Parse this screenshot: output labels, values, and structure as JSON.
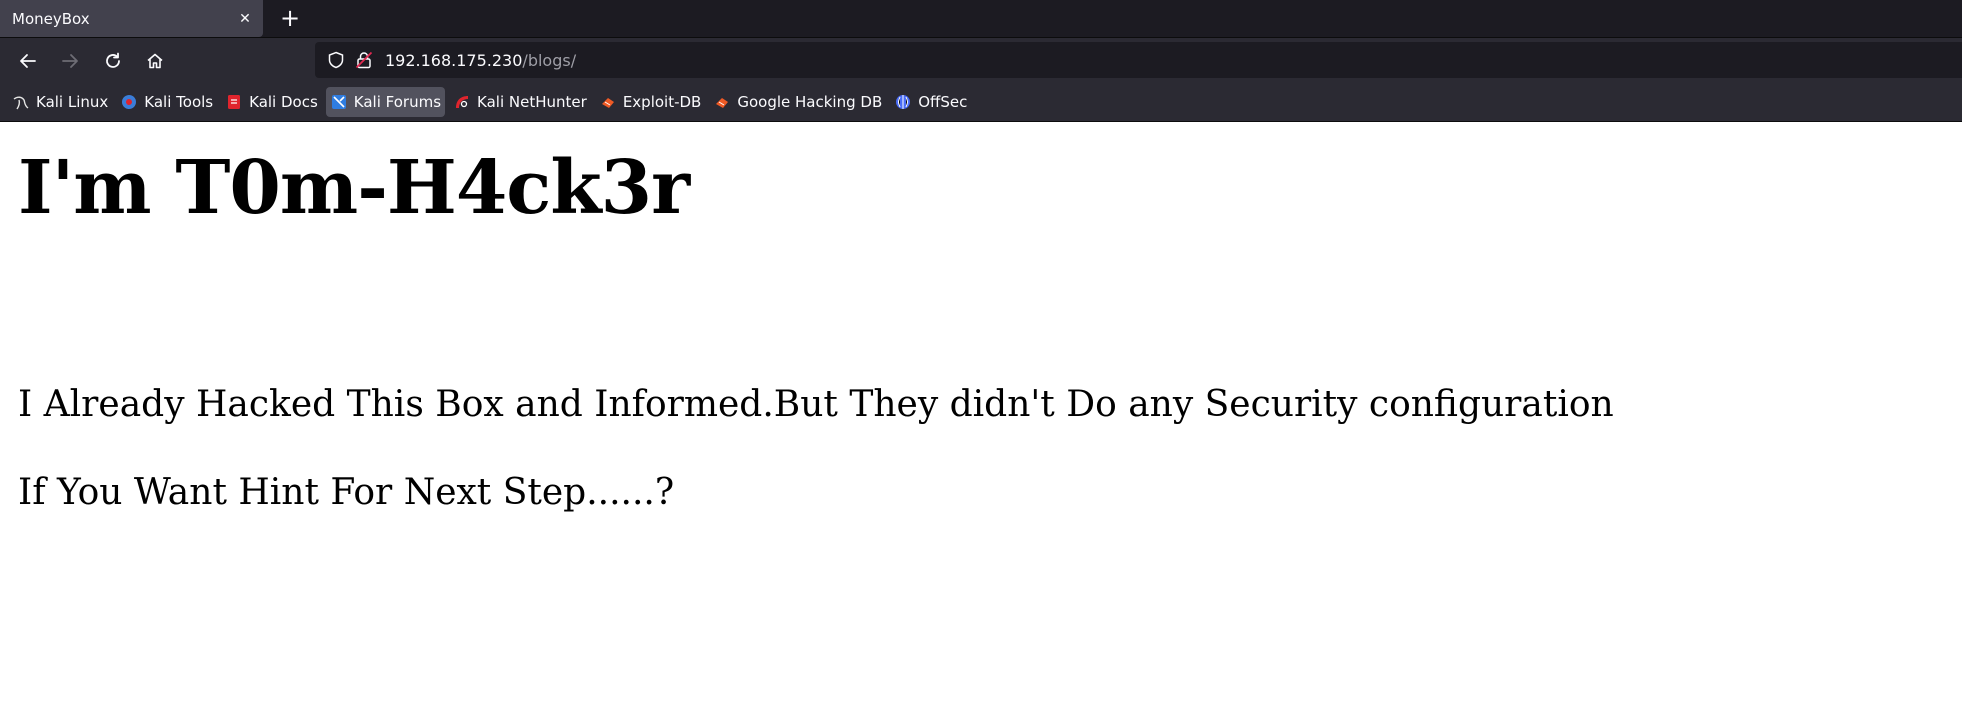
{
  "browser": {
    "tab": {
      "title": "MoneyBox",
      "close_glyph": "✕"
    },
    "new_tab_glyph": "+",
    "address": {
      "host": "192.168.175.230",
      "path": "/blogs/"
    },
    "bookmarks": [
      {
        "label": "Kali Linux",
        "icon": "kali-dragon-icon",
        "color": "#e5e5e5"
      },
      {
        "label": "Kali Tools",
        "icon": "kali-tools-icon",
        "color": "#3b7dd8"
      },
      {
        "label": "Kali Docs",
        "icon": "kali-docs-icon",
        "color": "#e0242d"
      },
      {
        "label": "Kali Forums",
        "icon": "kali-forums-icon",
        "color": "#2f7de1"
      },
      {
        "label": "Kali NetHunter",
        "icon": "nethunter-icon",
        "color": "#e0242d"
      },
      {
        "label": "Exploit-DB",
        "icon": "exploit-db-icon",
        "color": "#ef5a25"
      },
      {
        "label": "Google Hacking DB",
        "icon": "ghdb-icon",
        "color": "#ef5a25"
      },
      {
        "label": "OffSec",
        "icon": "offsec-icon",
        "color": "#4a6cf7"
      }
    ],
    "active_bookmark": "Kali Forums"
  },
  "page": {
    "heading": "I'm T0m-H4ck3r",
    "line1": "I Already Hacked This Box and Informed.But They didn't Do any Security configuration",
    "line2": "If You Want Hint For Next Step......?"
  }
}
